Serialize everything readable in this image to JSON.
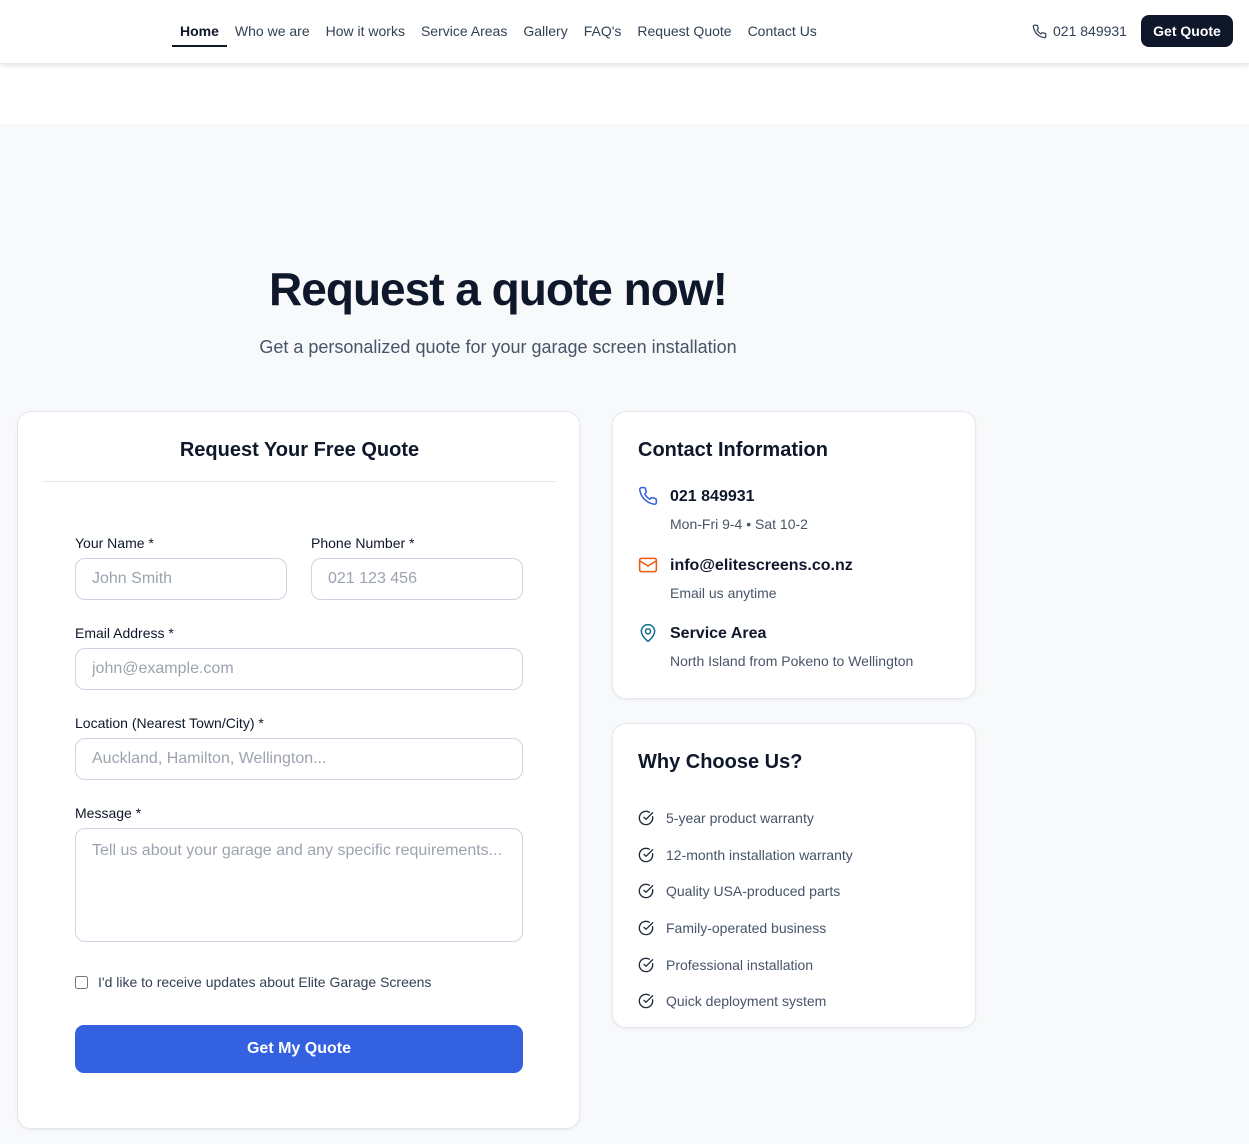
{
  "nav": {
    "items": [
      {
        "label": "Home",
        "active": true
      },
      {
        "label": "Who we are"
      },
      {
        "label": "How it works"
      },
      {
        "label": "Service Areas"
      },
      {
        "label": "Gallery"
      },
      {
        "label": "FAQ's"
      },
      {
        "label": "Request Quote"
      },
      {
        "label": "Contact Us"
      }
    ],
    "phone": "021 849931",
    "cta_label": "Get Quote",
    "phone_icon": "phone-icon"
  },
  "hero": {
    "title": "Request a quote now!",
    "subtitle": "Get a personalized quote for your garage screen installation"
  },
  "form": {
    "title": "Request Your Free Quote",
    "name": {
      "label": "Your Name *",
      "placeholder": "John Smith",
      "value": ""
    },
    "phone": {
      "label": "Phone Number *",
      "placeholder": "021 123 456",
      "value": ""
    },
    "email": {
      "label": "Email Address *",
      "placeholder": "john@example.com",
      "value": ""
    },
    "location": {
      "label": "Location (Nearest Town/City) *",
      "placeholder": "Auckland, Hamilton, Wellington...",
      "value": ""
    },
    "message": {
      "label": "Message *",
      "placeholder": "Tell us about your garage and any specific requirements...",
      "value": ""
    },
    "updates_label": "I'd like to receive updates about Elite Garage Screens",
    "updates_checked": false,
    "submit_label": "Get My Quote"
  },
  "contact": {
    "heading": "Contact Information",
    "items": [
      {
        "icon": "phone-icon",
        "main": "021 849931",
        "sub": "Mon-Fri 9-4 • Sat 10-2",
        "color": "#3461e0"
      },
      {
        "icon": "mail-icon",
        "main": "info@elitescreens.co.nz",
        "sub": "Email us anytime",
        "color": "#ea580c"
      },
      {
        "icon": "map-pin-icon",
        "main": "Service Area",
        "sub": "North Island from Pokeno to Wellington",
        "color": "#0f6e8c"
      }
    ]
  },
  "why": {
    "heading": "Why Choose Us?",
    "icon": "check-circle-icon",
    "items": [
      "5-year product warranty",
      "12-month installation warranty",
      "Quality USA-produced parts",
      "Family-operated business",
      "Professional installation",
      "Quick deployment system"
    ]
  },
  "colors": {
    "primary_button": "#3461e0",
    "dark": "#0f172a",
    "section_bg": "#f8f9fa"
  }
}
